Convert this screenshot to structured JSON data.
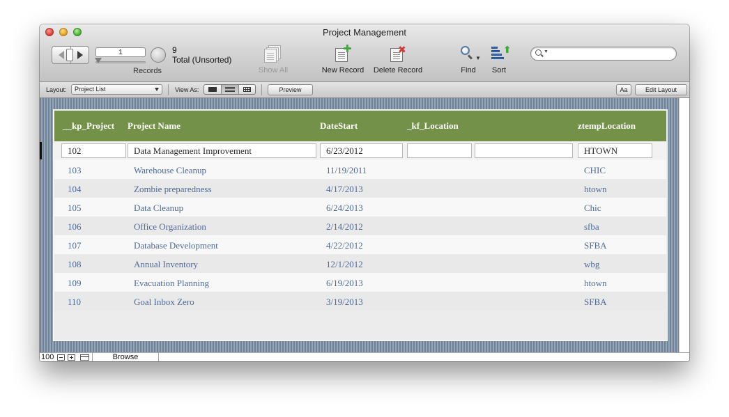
{
  "window": {
    "title": "Project Management"
  },
  "toolbar": {
    "current_record": "1",
    "found_count": "9",
    "total_status": "Total (Unsorted)",
    "records_label": "Records",
    "show_all_label": "Show All",
    "new_record_label": "New Record",
    "delete_record_label": "Delete Record",
    "find_label": "Find",
    "sort_label": "Sort",
    "search_placeholder": ""
  },
  "layout_bar": {
    "layout_label": "Layout:",
    "layout_value": "Project List",
    "view_as_label": "View As:",
    "preview_label": "Preview",
    "text_format_label": "Aa",
    "edit_layout_label": "Edit Layout"
  },
  "table": {
    "headers": [
      "__kp_Project",
      "Project Name",
      "DateStart",
      "_kf_Location",
      "ztempLocation"
    ],
    "rows": [
      {
        "id": "102",
        "name": "Data Management Improvement",
        "date": "6/23/2012",
        "kf_location": "",
        "ztemp": "HTOWN"
      },
      {
        "id": "103",
        "name": "Warehouse Cleanup",
        "date": "11/19/2011",
        "kf_location": "",
        "ztemp": "CHIC"
      },
      {
        "id": "104",
        "name": "Zombie preparedness",
        "date": "4/17/2013",
        "kf_location": "",
        "ztemp": "htown"
      },
      {
        "id": "105",
        "name": "Data Cleanup",
        "date": "6/24/2013",
        "kf_location": "",
        "ztemp": "Chic"
      },
      {
        "id": "106",
        "name": "Office Organization",
        "date": "2/14/2012",
        "kf_location": "",
        "ztemp": "sfba"
      },
      {
        "id": "107",
        "name": "Database Development",
        "date": "4/22/2012",
        "kf_location": "",
        "ztemp": "SFBA"
      },
      {
        "id": "108",
        "name": "Annual Inventory",
        "date": "12/1/2012",
        "kf_location": "",
        "ztemp": "wbg"
      },
      {
        "id": "109",
        "name": "Evacuation Planning",
        "date": "6/19/2013",
        "kf_location": "",
        "ztemp": "htown"
      },
      {
        "id": "110",
        "name": "Goal Inbox Zero",
        "date": "3/19/2013",
        "kf_location": "",
        "ztemp": "SFBA"
      }
    ]
  },
  "status_bar": {
    "zoom": "100",
    "mode": "Browse"
  },
  "colors": {
    "header_bg": "#739148",
    "row_text": "#4e6a98",
    "background_stripes": "#8194a8"
  },
  "icons": {
    "close": "close-icon",
    "minimize": "minimize-icon",
    "maximize": "maximize-icon",
    "show_all": "show-all-icon",
    "new_record": "new-record-icon",
    "delete_record": "delete-record-icon",
    "find": "find-icon",
    "sort": "sort-icon",
    "search": "search-icon"
  }
}
